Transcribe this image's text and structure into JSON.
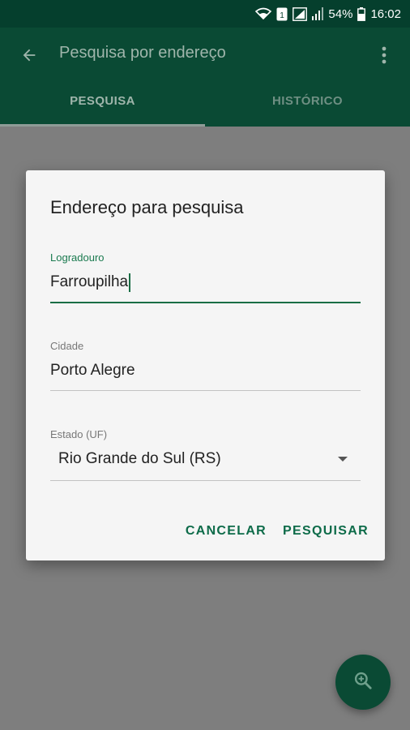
{
  "status_bar": {
    "battery_text": "54%",
    "time": "16:02",
    "icons": [
      "wifi-icon",
      "sim-badge-icon",
      "signal-box-icon",
      "signal-bars-icon",
      "battery-icon"
    ]
  },
  "app_bar": {
    "title": "Pesquisa por endereço",
    "back_icon": "arrow-back-icon",
    "menu_icon": "more-vert-icon"
  },
  "tabs": [
    {
      "label": "PESQUISA",
      "selected": true
    },
    {
      "label": "HISTÓRICO",
      "selected": false
    }
  ],
  "dialog": {
    "title": "Endereço para pesquisa",
    "fields": {
      "logradouro": {
        "label": "Logradouro",
        "value": "Farroupilha"
      },
      "cidade": {
        "label": "Cidade",
        "value": "Porto Alegre"
      },
      "estado": {
        "label": "Estado (UF)",
        "value": "Rio Grande do Sul (RS)"
      }
    },
    "buttons": {
      "cancel": "CANCELAR",
      "search": "PESQUISAR"
    }
  },
  "fab": {
    "icon": "zoom-in-search-icon"
  },
  "colors": {
    "primary_dark": "#053f2d",
    "primary": "#0a4a34",
    "accent": "#0d6b49",
    "scrim": "#7e7e7e",
    "dialog_bg": "#f5f5f5"
  }
}
